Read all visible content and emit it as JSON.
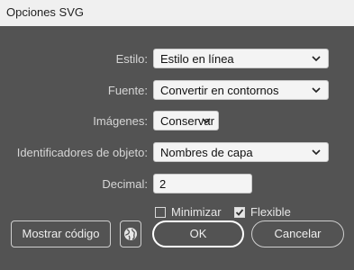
{
  "window": {
    "title": "Opciones SVG"
  },
  "fields": {
    "estilo": {
      "label": "Estilo:",
      "value": "Estilo en línea"
    },
    "fuente": {
      "label": "Fuente:",
      "value": "Convertir en contornos"
    },
    "imagenes": {
      "label": "Imágenes:",
      "value": "Conservar"
    },
    "identificadores": {
      "label": "Identificadores de objeto:",
      "value": "Nombres de capa"
    },
    "decimal": {
      "label": "Decimal:",
      "value": "2"
    }
  },
  "options": {
    "minimizar": {
      "label": "Minimizar",
      "checked": false
    },
    "flexible": {
      "label": "Flexible",
      "checked": true
    }
  },
  "buttons": {
    "show_code": "Mostrar código",
    "ok": "OK",
    "cancel": "Cancelar"
  },
  "icons": {
    "web": "globe-icon",
    "dropdown": "chevron-down-icon"
  }
}
